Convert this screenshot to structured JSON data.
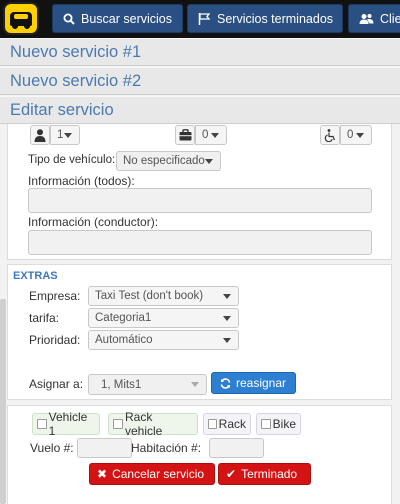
{
  "header": {
    "buttons": [
      {
        "label": "Buscar servicios",
        "icon": "search-icon"
      },
      {
        "label": "Servicios terminados",
        "icon": "flag-icon"
      },
      {
        "label": "Clie",
        "icon": "users-icon"
      }
    ]
  },
  "accordion": [
    {
      "label": "Nuevo servicio #1"
    },
    {
      "label": "Nuevo servicio #2"
    },
    {
      "label": "Editar servicio"
    }
  ],
  "counts": {
    "passengers": "1",
    "luggage": "0",
    "wheelchair": "0"
  },
  "vehicle": {
    "label": "Tipo de vehículo:",
    "value": "No especificado"
  },
  "info_all": {
    "label": "Información (todos):",
    "value": ""
  },
  "info_driver": {
    "label": "Información (conductor):",
    "value": ""
  },
  "extras": {
    "title": "EXTRAS",
    "company_label": "Empresa:",
    "company_value": "Taxi Test (don't book)",
    "rate_label": "tarifa:",
    "rate_value": "Categoria1",
    "priority_label": "Prioridad:",
    "priority_value": "Automático",
    "assign_label": "Asignar a:",
    "assign_value": "1, Mits1",
    "reassign_label": "reasignar"
  },
  "options": [
    {
      "label": "Vehicle 1"
    },
    {
      "label": "Rack vehicle"
    },
    {
      "label": "Rack"
    },
    {
      "label": "Bike"
    }
  ],
  "flight": {
    "label": "Vuelo #:",
    "value": ""
  },
  "room": {
    "label": "Habitación #:",
    "value": ""
  },
  "actions": {
    "cancel_label": "Cancelar servicio",
    "done_label": "Terminado"
  },
  "colors": {
    "topbar": "#111111",
    "nav_button": "#2a4f82",
    "accordion_text": "#4a7ab0",
    "primary": "#2d7fd1",
    "danger": "#d41414",
    "logo": "#ffd000"
  }
}
